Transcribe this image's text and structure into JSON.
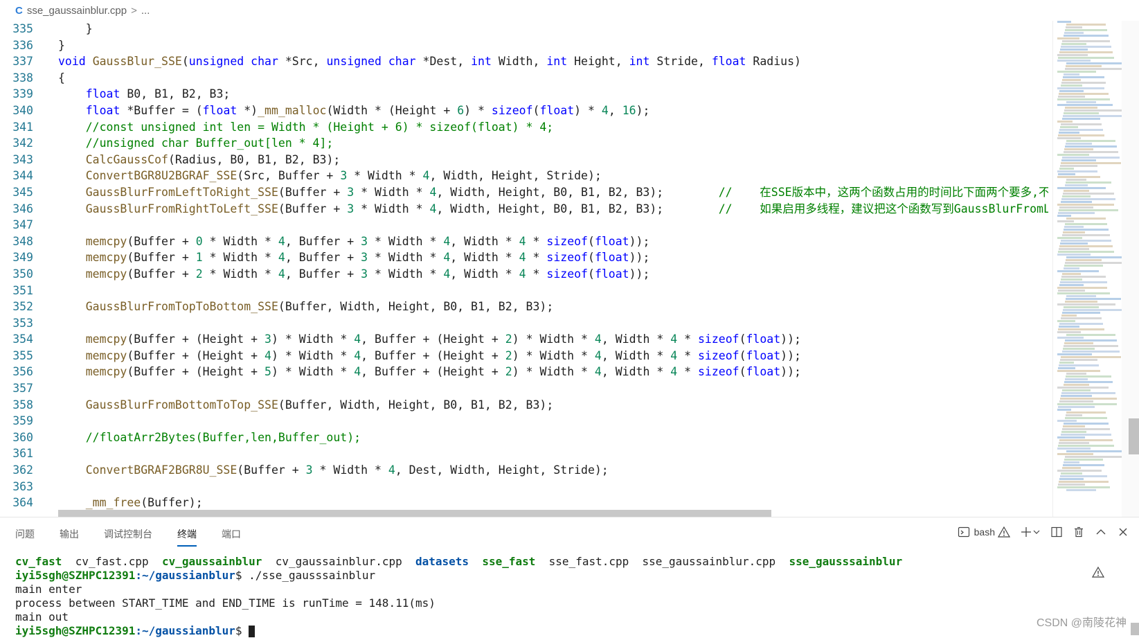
{
  "breadcrumb": {
    "file": "sse_gaussainblur.cpp",
    "chevron": ">",
    "more": "...",
    "icon": "cpp-file-icon"
  },
  "editor": {
    "lines": [
      {
        "n": "335",
        "tokens": [
          {
            "t": "    }",
            "c": "pl"
          }
        ]
      },
      {
        "n": "336",
        "tokens": [
          {
            "t": "}",
            "c": "pl"
          }
        ]
      },
      {
        "n": "337",
        "tokens": [
          {
            "t": "void",
            "c": "kw"
          },
          {
            "t": " ",
            "c": "pl"
          },
          {
            "t": "GaussBlur_SSE",
            "c": "fn"
          },
          {
            "t": "(",
            "c": "pl"
          },
          {
            "t": "unsigned char",
            "c": "kw"
          },
          {
            "t": " *Src, ",
            "c": "pl"
          },
          {
            "t": "unsigned char",
            "c": "kw"
          },
          {
            "t": " *Dest, ",
            "c": "pl"
          },
          {
            "t": "int",
            "c": "kw"
          },
          {
            "t": " Width, ",
            "c": "pl"
          },
          {
            "t": "int",
            "c": "kw"
          },
          {
            "t": " Height, ",
            "c": "pl"
          },
          {
            "t": "int",
            "c": "kw"
          },
          {
            "t": " Stride, ",
            "c": "pl"
          },
          {
            "t": "float",
            "c": "kw"
          },
          {
            "t": " Radius)",
            "c": "pl"
          }
        ]
      },
      {
        "n": "338",
        "tokens": [
          {
            "t": "{",
            "c": "pl"
          }
        ]
      },
      {
        "n": "339",
        "tokens": [
          {
            "t": "    ",
            "c": "pl"
          },
          {
            "t": "float",
            "c": "kw"
          },
          {
            "t": " B0, B1, B2, B3;",
            "c": "pl"
          }
        ]
      },
      {
        "n": "340",
        "tokens": [
          {
            "t": "    ",
            "c": "pl"
          },
          {
            "t": "float",
            "c": "kw"
          },
          {
            "t": " *Buffer = (",
            "c": "pl"
          },
          {
            "t": "float",
            "c": "kw"
          },
          {
            "t": " *)",
            "c": "pl"
          },
          {
            "t": "_mm_malloc",
            "c": "fn"
          },
          {
            "t": "(Width * (Height + ",
            "c": "pl"
          },
          {
            "t": "6",
            "c": "nm"
          },
          {
            "t": ") * ",
            "c": "pl"
          },
          {
            "t": "sizeof",
            "c": "kw"
          },
          {
            "t": "(",
            "c": "pl"
          },
          {
            "t": "float",
            "c": "kw"
          },
          {
            "t": ") * ",
            "c": "pl"
          },
          {
            "t": "4",
            "c": "nm"
          },
          {
            "t": ", ",
            "c": "pl"
          },
          {
            "t": "16",
            "c": "nm"
          },
          {
            "t": ");",
            "c": "pl"
          }
        ]
      },
      {
        "n": "341",
        "tokens": [
          {
            "t": "    //const unsigned int len = Width * (Height + 6) * sizeof(float) * 4;",
            "c": "cm"
          }
        ]
      },
      {
        "n": "342",
        "tokens": [
          {
            "t": "    //unsigned char Buffer_out[len * 4];",
            "c": "cm"
          }
        ]
      },
      {
        "n": "343",
        "tokens": [
          {
            "t": "    ",
            "c": "pl"
          },
          {
            "t": "CalcGaussCof",
            "c": "fn"
          },
          {
            "t": "(Radius, B0, B1, B2, B3);",
            "c": "pl"
          }
        ]
      },
      {
        "n": "344",
        "tokens": [
          {
            "t": "    ",
            "c": "pl"
          },
          {
            "t": "ConvertBGR8U2BGRAF_SSE",
            "c": "fn"
          },
          {
            "t": "(Src, Buffer + ",
            "c": "pl"
          },
          {
            "t": "3",
            "c": "nm"
          },
          {
            "t": " * Width * ",
            "c": "pl"
          },
          {
            "t": "4",
            "c": "nm"
          },
          {
            "t": ", Width, Height, Stride);",
            "c": "pl"
          }
        ]
      },
      {
        "n": "345",
        "tokens": [
          {
            "t": "    ",
            "c": "pl"
          },
          {
            "t": "GaussBlurFromLeftToRight_SSE",
            "c": "fn"
          },
          {
            "t": "(Buffer + ",
            "c": "pl"
          },
          {
            "t": "3",
            "c": "nm"
          },
          {
            "t": " * Width * ",
            "c": "pl"
          },
          {
            "t": "4",
            "c": "nm"
          },
          {
            "t": ", Width, Height, B0, B1, B2, B3);        ",
            "c": "pl"
          },
          {
            "t": "//    在SSE版本中，这两个函数占用的时间比下面两个要多,不",
            "c": "cm"
          }
        ]
      },
      {
        "n": "346",
        "tokens": [
          {
            "t": "    ",
            "c": "pl"
          },
          {
            "t": "GaussBlurFromRightToLeft_SSE",
            "c": "fn"
          },
          {
            "t": "(Buffer + ",
            "c": "pl"
          },
          {
            "t": "3",
            "c": "nm"
          },
          {
            "t": " * Width * ",
            "c": "pl"
          },
          {
            "t": "4",
            "c": "nm"
          },
          {
            "t": ", Width, Height, B0, B1, B2, B3);        ",
            "c": "pl"
          },
          {
            "t": "//    如果启用多线程，建议把这个函数写到GaussBlurFromLe",
            "c": "cm"
          }
        ]
      },
      {
        "n": "347",
        "tokens": [
          {
            "t": "",
            "c": "pl"
          }
        ]
      },
      {
        "n": "348",
        "tokens": [
          {
            "t": "    ",
            "c": "pl"
          },
          {
            "t": "memcpy",
            "c": "fn"
          },
          {
            "t": "(Buffer + ",
            "c": "pl"
          },
          {
            "t": "0",
            "c": "nm"
          },
          {
            "t": " * Width * ",
            "c": "pl"
          },
          {
            "t": "4",
            "c": "nm"
          },
          {
            "t": ", Buffer + ",
            "c": "pl"
          },
          {
            "t": "3",
            "c": "nm"
          },
          {
            "t": " * Width * ",
            "c": "pl"
          },
          {
            "t": "4",
            "c": "nm"
          },
          {
            "t": ", Width * ",
            "c": "pl"
          },
          {
            "t": "4",
            "c": "nm"
          },
          {
            "t": " * ",
            "c": "pl"
          },
          {
            "t": "sizeof",
            "c": "kw"
          },
          {
            "t": "(",
            "c": "pl"
          },
          {
            "t": "float",
            "c": "kw"
          },
          {
            "t": "));",
            "c": "pl"
          }
        ]
      },
      {
        "n": "349",
        "tokens": [
          {
            "t": "    ",
            "c": "pl"
          },
          {
            "t": "memcpy",
            "c": "fn"
          },
          {
            "t": "(Buffer + ",
            "c": "pl"
          },
          {
            "t": "1",
            "c": "nm"
          },
          {
            "t": " * Width * ",
            "c": "pl"
          },
          {
            "t": "4",
            "c": "nm"
          },
          {
            "t": ", Buffer + ",
            "c": "pl"
          },
          {
            "t": "3",
            "c": "nm"
          },
          {
            "t": " * Width * ",
            "c": "pl"
          },
          {
            "t": "4",
            "c": "nm"
          },
          {
            "t": ", Width * ",
            "c": "pl"
          },
          {
            "t": "4",
            "c": "nm"
          },
          {
            "t": " * ",
            "c": "pl"
          },
          {
            "t": "sizeof",
            "c": "kw"
          },
          {
            "t": "(",
            "c": "pl"
          },
          {
            "t": "float",
            "c": "kw"
          },
          {
            "t": "));",
            "c": "pl"
          }
        ]
      },
      {
        "n": "350",
        "tokens": [
          {
            "t": "    ",
            "c": "pl"
          },
          {
            "t": "memcpy",
            "c": "fn"
          },
          {
            "t": "(Buffer + ",
            "c": "pl"
          },
          {
            "t": "2",
            "c": "nm"
          },
          {
            "t": " * Width * ",
            "c": "pl"
          },
          {
            "t": "4",
            "c": "nm"
          },
          {
            "t": ", Buffer + ",
            "c": "pl"
          },
          {
            "t": "3",
            "c": "nm"
          },
          {
            "t": " * Width * ",
            "c": "pl"
          },
          {
            "t": "4",
            "c": "nm"
          },
          {
            "t": ", Width * ",
            "c": "pl"
          },
          {
            "t": "4",
            "c": "nm"
          },
          {
            "t": " * ",
            "c": "pl"
          },
          {
            "t": "sizeof",
            "c": "kw"
          },
          {
            "t": "(",
            "c": "pl"
          },
          {
            "t": "float",
            "c": "kw"
          },
          {
            "t": "));",
            "c": "pl"
          }
        ]
      },
      {
        "n": "351",
        "tokens": [
          {
            "t": "",
            "c": "pl"
          }
        ]
      },
      {
        "n": "352",
        "tokens": [
          {
            "t": "    ",
            "c": "pl"
          },
          {
            "t": "GaussBlurFromTopToBottom_SSE",
            "c": "fn"
          },
          {
            "t": "(Buffer, Width, Height, B0, B1, B2, B3);",
            "c": "pl"
          }
        ]
      },
      {
        "n": "353",
        "tokens": [
          {
            "t": "",
            "c": "pl"
          }
        ]
      },
      {
        "n": "354",
        "tokens": [
          {
            "t": "    ",
            "c": "pl"
          },
          {
            "t": "memcpy",
            "c": "fn"
          },
          {
            "t": "(Buffer + (Height + ",
            "c": "pl"
          },
          {
            "t": "3",
            "c": "nm"
          },
          {
            "t": ") * Width * ",
            "c": "pl"
          },
          {
            "t": "4",
            "c": "nm"
          },
          {
            "t": ", Buffer + (Height + ",
            "c": "pl"
          },
          {
            "t": "2",
            "c": "nm"
          },
          {
            "t": ") * Width * ",
            "c": "pl"
          },
          {
            "t": "4",
            "c": "nm"
          },
          {
            "t": ", Width * ",
            "c": "pl"
          },
          {
            "t": "4",
            "c": "nm"
          },
          {
            "t": " * ",
            "c": "pl"
          },
          {
            "t": "sizeof",
            "c": "kw"
          },
          {
            "t": "(",
            "c": "pl"
          },
          {
            "t": "float",
            "c": "kw"
          },
          {
            "t": "));",
            "c": "pl"
          }
        ]
      },
      {
        "n": "355",
        "tokens": [
          {
            "t": "    ",
            "c": "pl"
          },
          {
            "t": "memcpy",
            "c": "fn"
          },
          {
            "t": "(Buffer + (Height + ",
            "c": "pl"
          },
          {
            "t": "4",
            "c": "nm"
          },
          {
            "t": ") * Width * ",
            "c": "pl"
          },
          {
            "t": "4",
            "c": "nm"
          },
          {
            "t": ", Buffer + (Height + ",
            "c": "pl"
          },
          {
            "t": "2",
            "c": "nm"
          },
          {
            "t": ") * Width * ",
            "c": "pl"
          },
          {
            "t": "4",
            "c": "nm"
          },
          {
            "t": ", Width * ",
            "c": "pl"
          },
          {
            "t": "4",
            "c": "nm"
          },
          {
            "t": " * ",
            "c": "pl"
          },
          {
            "t": "sizeof",
            "c": "kw"
          },
          {
            "t": "(",
            "c": "pl"
          },
          {
            "t": "float",
            "c": "kw"
          },
          {
            "t": "));",
            "c": "pl"
          }
        ]
      },
      {
        "n": "356",
        "tokens": [
          {
            "t": "    ",
            "c": "pl"
          },
          {
            "t": "memcpy",
            "c": "fn"
          },
          {
            "t": "(Buffer + (Height + ",
            "c": "pl"
          },
          {
            "t": "5",
            "c": "nm"
          },
          {
            "t": ") * Width * ",
            "c": "pl"
          },
          {
            "t": "4",
            "c": "nm"
          },
          {
            "t": ", Buffer + (Height + ",
            "c": "pl"
          },
          {
            "t": "2",
            "c": "nm"
          },
          {
            "t": ") * Width * ",
            "c": "pl"
          },
          {
            "t": "4",
            "c": "nm"
          },
          {
            "t": ", Width * ",
            "c": "pl"
          },
          {
            "t": "4",
            "c": "nm"
          },
          {
            "t": " * ",
            "c": "pl"
          },
          {
            "t": "sizeof",
            "c": "kw"
          },
          {
            "t": "(",
            "c": "pl"
          },
          {
            "t": "float",
            "c": "kw"
          },
          {
            "t": "));",
            "c": "pl"
          }
        ]
      },
      {
        "n": "357",
        "tokens": [
          {
            "t": "",
            "c": "pl"
          }
        ]
      },
      {
        "n": "358",
        "tokens": [
          {
            "t": "    ",
            "c": "pl"
          },
          {
            "t": "GaussBlurFromBottomToTop_SSE",
            "c": "fn"
          },
          {
            "t": "(Buffer, Width, Height, B0, B1, B2, B3);",
            "c": "pl"
          }
        ]
      },
      {
        "n": "359",
        "tokens": [
          {
            "t": "",
            "c": "pl"
          }
        ]
      },
      {
        "n": "360",
        "tokens": [
          {
            "t": "    //floatArr2Bytes(Buffer,len,Buffer_out);",
            "c": "cm"
          }
        ]
      },
      {
        "n": "361",
        "tokens": [
          {
            "t": "",
            "c": "pl"
          }
        ]
      },
      {
        "n": "362",
        "tokens": [
          {
            "t": "    ",
            "c": "pl"
          },
          {
            "t": "ConvertBGRAF2BGR8U_SSE",
            "c": "fn"
          },
          {
            "t": "(Buffer + ",
            "c": "pl"
          },
          {
            "t": "3",
            "c": "nm"
          },
          {
            "t": " * Width * ",
            "c": "pl"
          },
          {
            "t": "4",
            "c": "nm"
          },
          {
            "t": ", Dest, Width, Height, Stride);",
            "c": "pl"
          }
        ]
      },
      {
        "n": "363",
        "tokens": [
          {
            "t": "",
            "c": "pl"
          }
        ]
      },
      {
        "n": "364",
        "tokens": [
          {
            "t": "    ",
            "c": "pl"
          },
          {
            "t": "_mm_free",
            "c": "fn"
          },
          {
            "t": "(Buffer);",
            "c": "pl"
          }
        ]
      }
    ]
  },
  "panel": {
    "tabs": [
      {
        "label": "问题",
        "active": false
      },
      {
        "label": "输出",
        "active": false
      },
      {
        "label": "调试控制台",
        "active": false
      },
      {
        "label": "终端",
        "active": true
      },
      {
        "label": "端口",
        "active": false
      }
    ],
    "terminal_name": "bash",
    "icons": [
      "terminal-icon",
      "warning-icon",
      "plus-icon",
      "chevron-down-icon",
      "split-icon",
      "trash-icon",
      "chevron-up-icon",
      "close-icon"
    ]
  },
  "terminal": {
    "ls_entries": [
      {
        "t": "cv_fast",
        "k": "exe"
      },
      {
        "t": "cv_fast.cpp",
        "k": "file"
      },
      {
        "t": "cv_gaussainblur",
        "k": "exe"
      },
      {
        "t": "cv_gaussainblur.cpp",
        "k": "file"
      },
      {
        "t": "datasets",
        "k": "dir"
      },
      {
        "t": "sse_fast",
        "k": "exe"
      },
      {
        "t": "sse_fast.cpp",
        "k": "file"
      },
      {
        "t": "sse_gaussainblur.cpp",
        "k": "file"
      },
      {
        "t": "sse_gausssainblur",
        "k": "exe"
      }
    ],
    "prompt_user": "iyi5sgh@SZHPC12391",
    "prompt_path": ":~/gaussianblur",
    "prompt_symbol": "$",
    "command": " ./sse_gausssainblur",
    "output": [
      "main enter",
      "process between START_TIME and END_TIME is runTime = 148.11(ms)",
      "main out"
    ]
  },
  "watermark": "CSDN @南陵花神",
  "colors": {
    "keyword": "#0000ff",
    "function": "#795e26",
    "comment": "#008000",
    "number": "#098658",
    "line_number": "#237893",
    "terminal_user": "#107c10",
    "terminal_path": "#0451a5"
  }
}
